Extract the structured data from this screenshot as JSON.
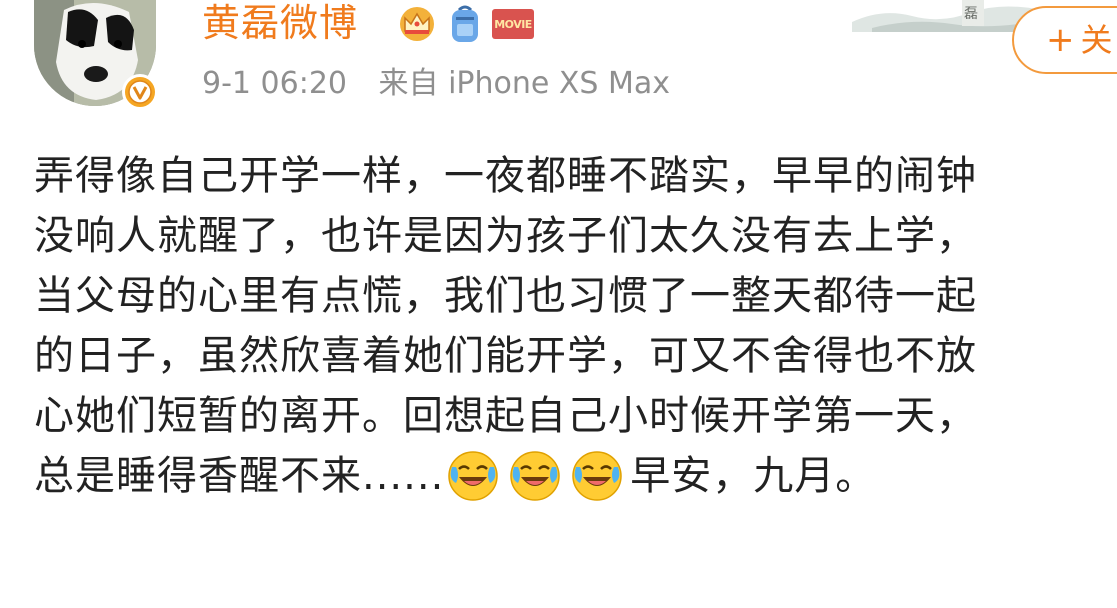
{
  "profile": {
    "username": "黄磊微博",
    "timestamp": "9-1 06:20",
    "source": "来自 iPhone XS Max",
    "badges": [
      "crown-icon",
      "backpack-icon",
      "movie-badge"
    ],
    "movie_badge_text": "MOVIE",
    "verified_text": "V"
  },
  "follow": {
    "plus": "+",
    "label": "关"
  },
  "post": {
    "lines": [
      "弄得像自己开学一样，一夜都睡不踏实，早早的闹钟",
      "没响人就醒了，也许是因为孩子们太久没有去上学，",
      "当父母的心里有点慌，我们也习惯了一整天都待一起",
      "的日子，虽然欣喜着她们能开学，可又不舍得也不放",
      "心她们短暂的离开。回想起自己小时候开学第一天，",
      "总是睡得香醒不来......"
    ],
    "emojis": [
      "laugh-cry-icon",
      "laugh-cry-icon",
      "laugh-cry-icon"
    ],
    "ending": "早安，九月。"
  },
  "colors": {
    "accent": "#f07b1d",
    "meta": "#8f8f8f",
    "verified": "#f5a623"
  }
}
